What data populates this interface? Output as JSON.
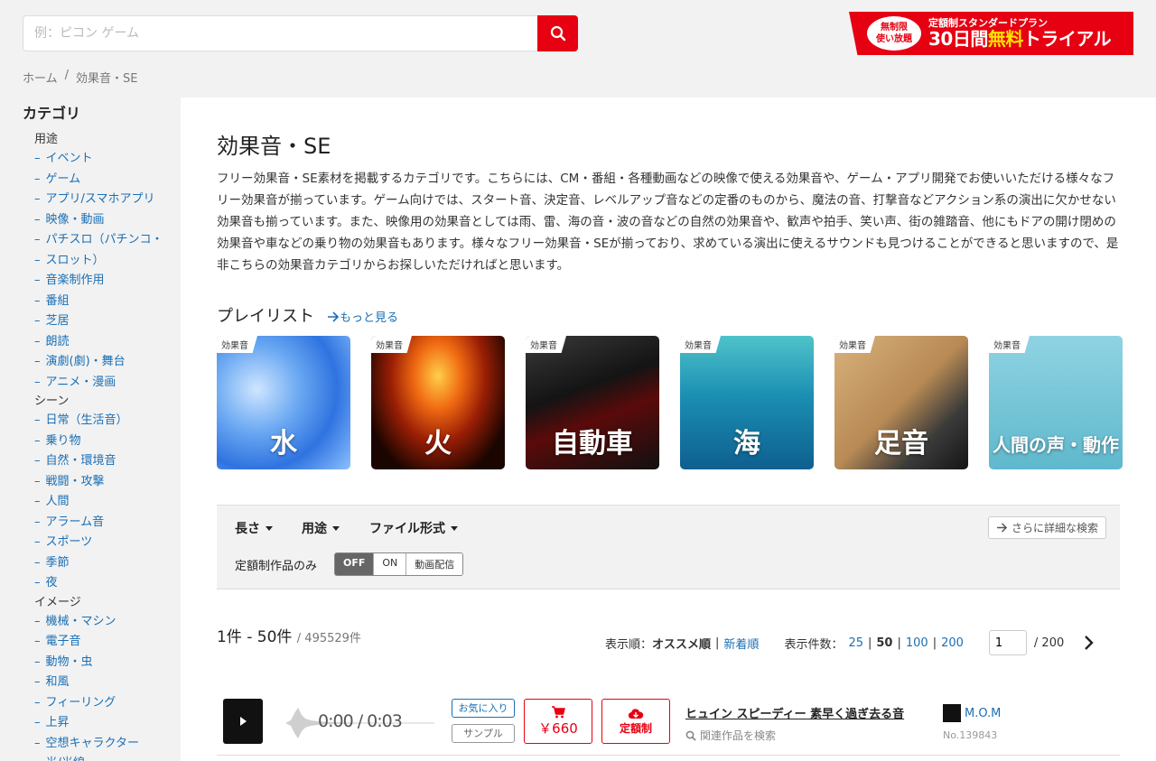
{
  "header": {
    "search_placeholder": "例：ピコン ゲーム",
    "banner": {
      "badge": "無制限\n使い放題",
      "line1": "定額制スタンダードプラン",
      "line2_a": "30日間",
      "line2_b": "無料",
      "line2_c": "トライアル"
    }
  },
  "breadcrumb": {
    "home": "ホーム",
    "sep": "/",
    "current": "効果音・SE"
  },
  "sidebar": {
    "title": "カテゴリ",
    "groups": [
      {
        "name": "用途",
        "items": [
          "イベント",
          "ゲーム",
          "アプリ/スマホアプリ",
          "映像・動画",
          "パチスロ（パチンコ・",
          "スロット）",
          "音楽制作用",
          "番組",
          "芝居",
          "朗読",
          "演劇(劇)・舞台",
          "アニメ・漫画"
        ]
      },
      {
        "name": "シーン",
        "items": [
          "日常（生活音）",
          "乗り物",
          "自然・環境音",
          "戦闘・攻撃",
          "人間",
          "アラーム音",
          "スポーツ",
          "季節",
          "夜"
        ]
      },
      {
        "name": "イメージ",
        "items": [
          "機械・マシン",
          "電子音",
          "動物・虫",
          "和風",
          "フィーリング",
          "上昇",
          "空想キャラクター",
          "光/光線"
        ]
      }
    ]
  },
  "main": {
    "title": "効果音・SE",
    "description": "フリー効果音・SE素材を掲載するカテゴリです。こちらには、CM・番組・各種動画などの映像で使える効果音や、ゲーム・アプリ開発でお使いいただける様々なフリー効果音が揃っています。ゲーム向けでは、スタート音、決定音、レベルアップ音などの定番のものから、魔法の音、打撃音などアクション系の演出に欠かせない効果音も揃っています。また、映像用の効果音としては雨、雷、海の音・波の音などの自然の効果音や、歓声や拍手、笑い声、街の雑踏音、他にもドアの開け閉めの効果音や車などの乗り物の効果音もあります。様々なフリー効果音・SEが揃っており、求めている演出に使えるサウンドも見つけることができると思いますので、是非こちらの効果音カテゴリからお探しいただければと思います。",
    "playlist_title": "プレイリスト",
    "playlist_more": "もっと見る",
    "playlists": [
      {
        "tag": "効果音",
        "label": "水"
      },
      {
        "tag": "効果音",
        "label": "火"
      },
      {
        "tag": "効果音",
        "label": "自動車"
      },
      {
        "tag": "効果音",
        "label": "海"
      },
      {
        "tag": "効果音",
        "label": "足音"
      },
      {
        "tag": "効果音",
        "label": "人間の声・動作"
      }
    ]
  },
  "filters": {
    "length": "長さ",
    "usage": "用途",
    "format": "ファイル形式",
    "advanced": "さらに詳細な検索",
    "subscription_label": "定額制作品のみ",
    "toggle": [
      "OFF",
      "ON",
      "動画配信"
    ]
  },
  "results": {
    "range": "1件 - 50件",
    "total": "/ 495529件",
    "sort_label": "表示順：",
    "sort_selected": "オススメ順",
    "sort_other": "新着順",
    "per_page_label": "表示件数：",
    "per_page": [
      "25",
      "50",
      "100",
      "200"
    ],
    "per_page_selected": "50",
    "page": "1",
    "pages": "/ 200"
  },
  "track": {
    "time": "0:00 / 0:03",
    "fav": "お気に入り",
    "sample": "サンプル",
    "price": "￥660",
    "subscription": "定額制",
    "title": "ヒュイン スピーディー 素早く過ぎ去る音",
    "related": "関連作品を検索",
    "author": "M.O.M",
    "number": "No.139843"
  },
  "colors": {
    "accent": "#e60012",
    "link": "#1a6fb5"
  }
}
